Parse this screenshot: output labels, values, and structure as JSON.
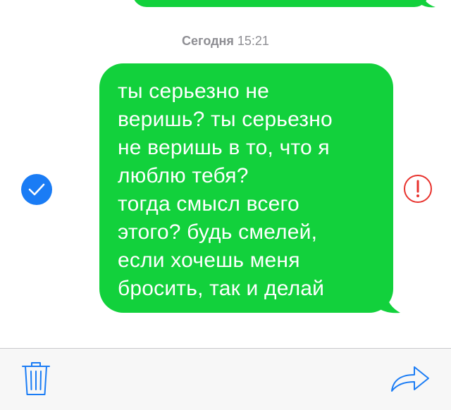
{
  "timestamp": {
    "day": "Сегодня",
    "time": "15:21"
  },
  "message": {
    "text": "ты серьезно не\nверишь? ты серьезно\nне веришь в то, что я\nлюблю тебя?\nтогда смысл всего\nэтого? будь смелей,\nесли хочешь меня\nбросить, так и делай",
    "selected": true,
    "status": "not-delivered"
  },
  "colors": {
    "bubble": "#12d13c",
    "accent": "#1a7cf5",
    "error": "#e8322d"
  },
  "icons": {
    "select": "checkmark-circle-icon",
    "status": "exclamation-circle-icon",
    "delete": "trash-icon",
    "forward": "forward-arrow-icon"
  }
}
